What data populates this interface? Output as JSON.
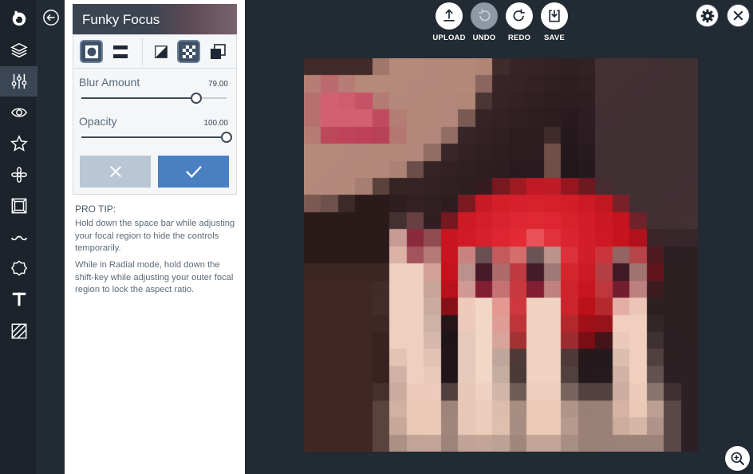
{
  "panel": {
    "title": "Funky Focus",
    "modes": [
      "radial-mode-icon",
      "linear-mode-icon",
      "blur-style-icon",
      "pixel-style-icon",
      "invert-icon"
    ],
    "blur": {
      "label": "Blur Amount",
      "value": "79.00",
      "fraction": 0.79
    },
    "opacity": {
      "label": "Opacity",
      "value": "100.00",
      "fraction": 1.0
    },
    "tip_title": "PRO TIP:",
    "tip_1": "Hold down the space bar while adjusting your focal region to hide the controls temporarily.",
    "tip_2": "While in Radial mode, hold down the shift-key while adjusting your outer focal region to lock the aspect ratio."
  },
  "toolbar": {
    "upload": "UPLOAD",
    "undo": "UNDO",
    "redo": "REDO",
    "save": "SAVE"
  },
  "rail": [
    "logo-icon",
    "layers-icon",
    "adjustments-icon",
    "eye-icon",
    "star-icon",
    "flower-icon",
    "frame-icon",
    "mustache-icon",
    "sticker-icon",
    "text-icon",
    "texture-icon"
  ],
  "colors": {
    "accent": "#4a7fc1",
    "rail_bg": "#1c232b",
    "workspace_bg": "#222a33"
  }
}
